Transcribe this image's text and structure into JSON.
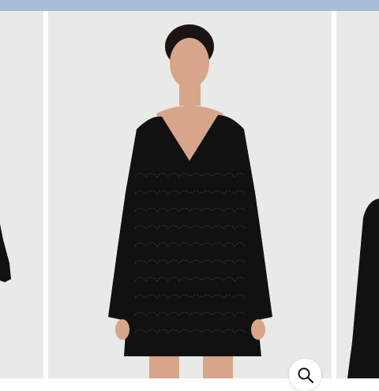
{
  "colors": {
    "top_bar": "#a9bed6",
    "photo_background": "#e9e9e7",
    "dress": "#111111",
    "skin": "#d6a58a",
    "hair": "#1a1412"
  },
  "gallery": {
    "slides": [
      {
        "position": "previous",
        "content": "black-knit-dress-sleeve-cropped"
      },
      {
        "position": "current",
        "content": "model-black-crochet-mini-dress"
      },
      {
        "position": "next",
        "content": "black-knit-dress-sleeve-cropped"
      }
    ],
    "zoom_icon": "magnifier-icon"
  }
}
